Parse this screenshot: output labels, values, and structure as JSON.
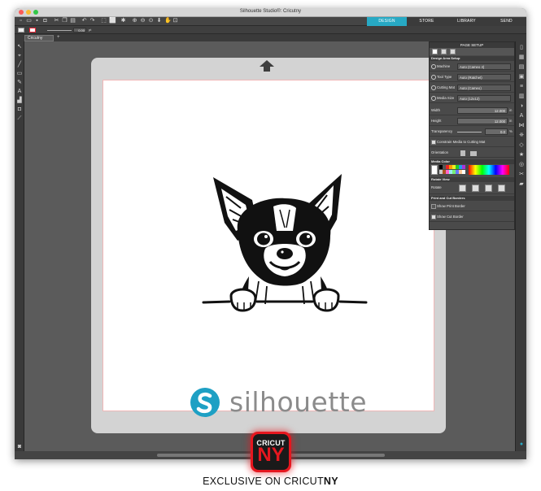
{
  "window": {
    "title": "Silhouette Studio®: Cricutny"
  },
  "nav_tabs": [
    {
      "label": "DESIGN",
      "color": "#27a9c4"
    },
    {
      "label": "STORE",
      "color": "#3b3b3b"
    },
    {
      "label": "LIBRARY",
      "color": "#3b3b3b"
    },
    {
      "label": "SEND",
      "color": "#3b3b3b"
    }
  ],
  "document": {
    "tab_label": "Cricutny"
  },
  "options_bar": {
    "line_width": "0.00",
    "unit": "pt"
  },
  "canvas": {
    "logo_text": "silhouette",
    "logo_color": "#1ea0c4",
    "image": "chihuahua-peeking-illustration"
  },
  "page_setup": {
    "title": "PAGE SETUP",
    "section_design": "Design Area Setup",
    "machine": {
      "label": "Machine",
      "value": "Auto (Cameo 4)"
    },
    "tool_type": {
      "label": "Tool Type",
      "value": "Auto (Ratchet)"
    },
    "cutting_mat": {
      "label": "Cutting Mat",
      "value": "Auto (Cameo)"
    },
    "media_size": {
      "label": "Media Size",
      "value": "Auto (12x12)"
    },
    "width": {
      "label": "Width",
      "value": "12.000",
      "unit": "in"
    },
    "height": {
      "label": "Height",
      "value": "12.000",
      "unit": "in"
    },
    "transparency": {
      "label": "Transparency",
      "value": "0.0",
      "unit": "%"
    },
    "constrain": {
      "label": "Constrain Media to Cutting Mat",
      "checked": true
    },
    "orientation_label": "Orientation",
    "section_media_color": "Media Color",
    "section_rotate_view": "Rotate View",
    "rotate_label": "Rotate",
    "section_print_cut": "Print and Cut Borders",
    "show_print_border": {
      "label": "Show Print Border",
      "checked": false
    },
    "show_cut_border": {
      "label": "Show Cut Border",
      "checked": true
    }
  },
  "badge": {
    "top": "CRICUT",
    "bottom": "NY"
  },
  "caption": {
    "prefix": "EXCLUSIVE ON CRICUT",
    "suffix": "NY"
  }
}
